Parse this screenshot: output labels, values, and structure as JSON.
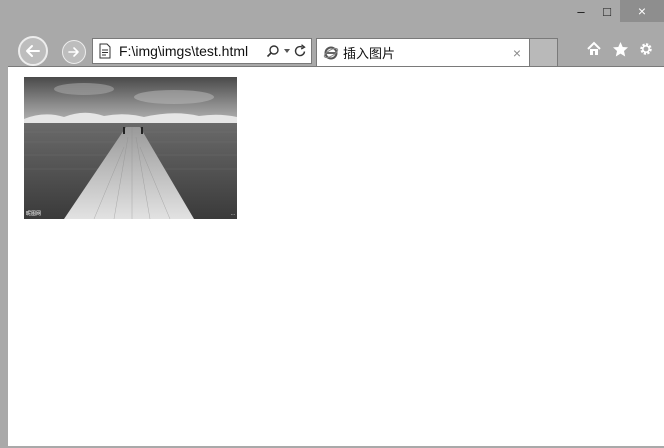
{
  "window": {
    "minimize_label": "–",
    "maximize_label": "□",
    "close_label": "×"
  },
  "nav": {
    "address": "F:\\img\\imgs\\test.html",
    "back_icon": "back-arrow-icon",
    "forward_icon": "forward-arrow-icon"
  },
  "tab": {
    "title": "插入图片",
    "close_label": "×"
  },
  "toolbar": {
    "icons": [
      "home-icon",
      "favorites-star-icon",
      "settings-gear-icon"
    ]
  },
  "content": {
    "image_alt": "pier-over-lake-photo",
    "caption_left": "昵图网",
    "caption_right": "..."
  },
  "colors": {
    "frame": "#a9a9a9",
    "close_button": "#8e8e8e",
    "page_background": "#ffffff"
  }
}
